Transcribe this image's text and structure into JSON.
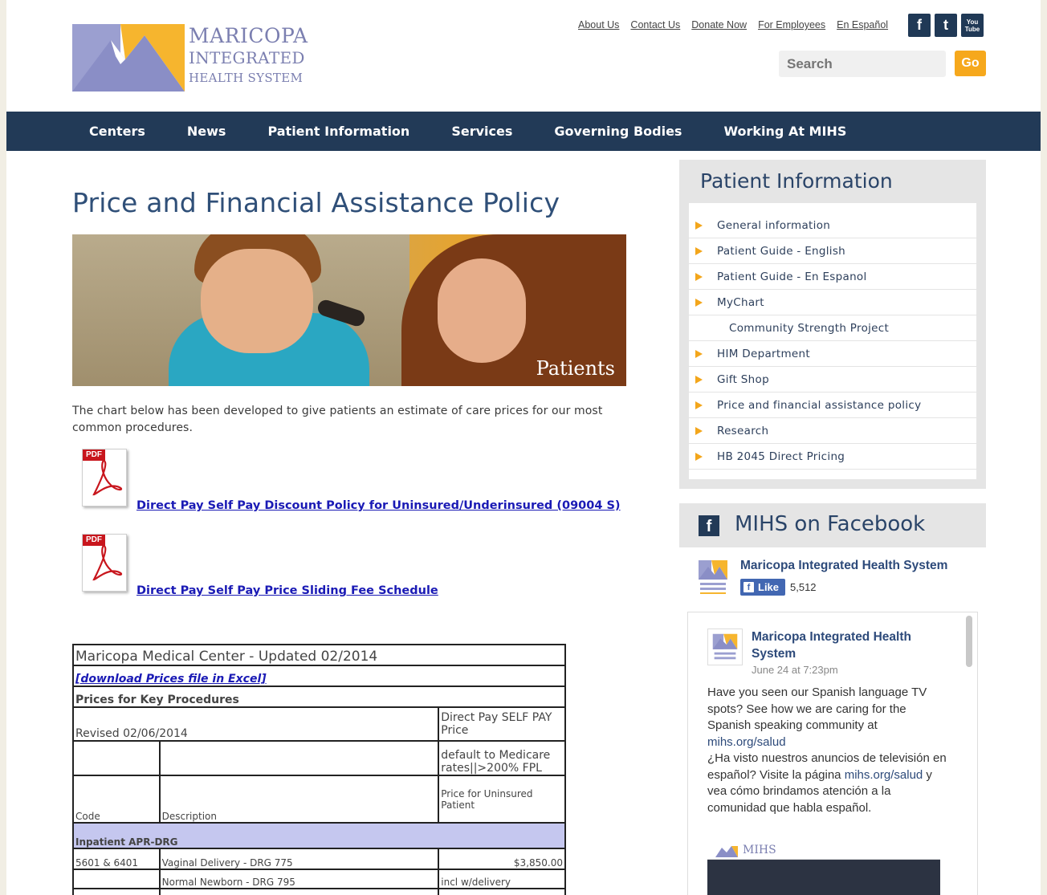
{
  "header": {
    "logo": {
      "line1": "MARICOPA",
      "line2": "INTEGRATED",
      "line3": "HEALTH SYSTEM"
    },
    "top_links": [
      "About Us",
      "Contact Us",
      "Donate Now",
      "For Employees",
      "En Español"
    ],
    "social": {
      "facebook": "f",
      "twitter": "t",
      "youtube_line1": "You",
      "youtube_line2": "Tube"
    },
    "search": {
      "placeholder": "Search"
    },
    "go_label": "Go"
  },
  "nav": [
    "Centers",
    "News",
    "Patient Information",
    "Services",
    "Governing Bodies",
    "Working At MIHS"
  ],
  "main": {
    "title": "Price and Financial Assistance Policy",
    "hero_caption": "Patients",
    "intro": "The chart below has been developed to give patients an estimate of care prices for our most common procedures.",
    "pdf_badge": "PDF",
    "pdf_links": [
      "Direct Pay Self Pay Discount Policy for Uninsured/Underinsured (09004 S)",
      "Direct Pay Self Pay Price Sliding Fee Schedule"
    ]
  },
  "table": {
    "title": "Maricopa Medical Center - Updated 02/2014",
    "download": "[download Prices file in Excel]",
    "key_procedures": "Prices for Key Procedures",
    "revised": "Revised 02/06/2014",
    "direct_pay": "Direct Pay SELF PAY Price",
    "default_medicare": "default to Medicare rates||>200% FPL",
    "col_code": "Code",
    "col_description": "Description",
    "col_price": "Price for Uninsured Patient",
    "group": "Inpatient APR-DRG",
    "rows": [
      {
        "code": "5601 & 6401",
        "description": "Vaginal Delivery  - DRG 775",
        "price": "$3,850.00"
      },
      {
        "code": "",
        "description": "Normal Newborn - DRG 795",
        "price": "incl w/delivery"
      }
    ]
  },
  "sidebar": {
    "title": "Patient Information",
    "items": [
      {
        "label": "General information",
        "sub": false
      },
      {
        "label": "Patient Guide - English",
        "sub": false
      },
      {
        "label": "Patient Guide - En Espanol",
        "sub": false
      },
      {
        "label": "MyChart",
        "sub": false
      },
      {
        "label": "Community Strength Project",
        "sub": true
      },
      {
        "label": "HIM Department",
        "sub": false
      },
      {
        "label": "Gift Shop",
        "sub": false
      },
      {
        "label": "Price and financial assistance policy",
        "sub": false
      },
      {
        "label": "Research",
        "sub": false
      },
      {
        "label": "HB 2045 Direct Pricing",
        "sub": false
      }
    ]
  },
  "facebook": {
    "heading_icon": "f",
    "heading": "MIHS on Facebook",
    "page_name": "Maricopa Integrated Health System",
    "like_label": "Like",
    "like_icon": "f",
    "like_count": "5,512",
    "post": {
      "author": "Maricopa Integrated Health System",
      "date": "June 24 at 7:23pm",
      "text_en": "Have you seen our Spanish language TV spots? See how we are caring for the Spanish speaking community at",
      "link1": "mihs.org/salud",
      "text_es": "¿Ha visto nuestros anuncios de televisión en español? Visite la página",
      "link2": "mihs.org/salud",
      "text_es2": "y vea cómo brindamos atención a la comunidad que habla español.",
      "video_brand": "MIHS"
    }
  },
  "colors": {
    "navy": "#223a57",
    "accent_orange": "#f6a81c",
    "logo_purple": "#7b7fb0",
    "title_blue": "#2f4f78"
  }
}
